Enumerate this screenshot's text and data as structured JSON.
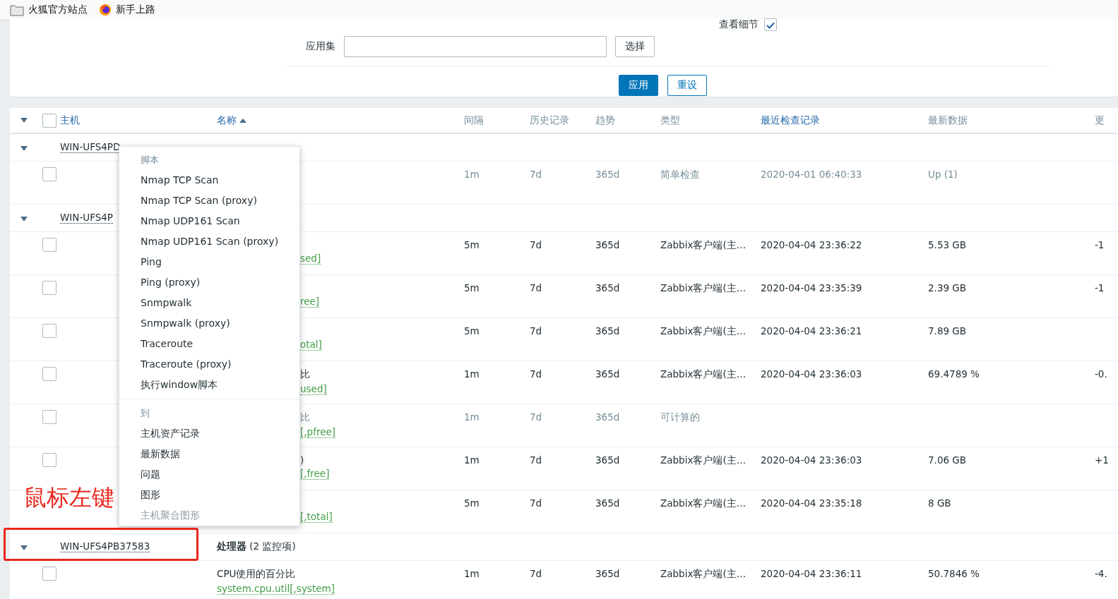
{
  "bookmarks": [
    {
      "label": "火狐官方站点"
    },
    {
      "label": "新手上路"
    }
  ],
  "filter": {
    "details_label": "查看细节",
    "details_checked": true,
    "app_label": "应用集",
    "select_button": "选择",
    "apply_button": "应用",
    "reset_button": "重设"
  },
  "table": {
    "header_checked": false,
    "columns": [
      {
        "label": "主机",
        "kind": "link"
      },
      {
        "label": "名称",
        "kind": "sorted"
      },
      {
        "label": "间隔",
        "kind": "plain"
      },
      {
        "label": "历史记录",
        "kind": "plain"
      },
      {
        "label": "趋势",
        "kind": "plain"
      },
      {
        "label": "类型",
        "kind": "plain"
      },
      {
        "label": "最近检查记录",
        "kind": "link"
      },
      {
        "label": "最新数据",
        "kind": "plain"
      },
      {
        "label": "更",
        "kind": "plain"
      }
    ],
    "groups": [
      {
        "host": "WIN-UFS4PD",
        "expanded": true,
        "rows": [
          {
            "checked": false,
            "disabled": true,
            "interval": "1m",
            "history": "7d",
            "trends": "365d",
            "type": "简单检查",
            "last_check": "2020-04-01 06:40:33",
            "last_value": "Up (1)"
          }
        ]
      },
      {
        "host": "WIN-UFS4P",
        "expanded": true,
        "rows": [
          {
            "checked": false,
            "disabled": false,
            "key": "sed]",
            "interval": "5m",
            "history": "7d",
            "trends": "365d",
            "type": "Zabbix客户端(主…",
            "last_check": "2020-04-04 23:36:22",
            "last_value": "5.53 GB",
            "change": "-1"
          },
          {
            "checked": false,
            "disabled": false,
            "key": "ree]",
            "interval": "5m",
            "history": "7d",
            "trends": "365d",
            "type": "Zabbix客户端(主…",
            "last_check": "2020-04-04 23:35:39",
            "last_value": "2.39 GB",
            "change": "-1"
          },
          {
            "checked": false,
            "disabled": false,
            "key": "otal]",
            "interval": "5m",
            "history": "7d",
            "trends": "365d",
            "type": "Zabbix客户端(主…",
            "last_check": "2020-04-04 23:36:21",
            "last_value": "7.89 GB"
          },
          {
            "checked": false,
            "disabled": false,
            "name": "比",
            "key": "used]",
            "interval": "1m",
            "history": "7d",
            "trends": "365d",
            "type": "Zabbix客户端(主…",
            "last_check": "2020-04-04 23:36:03",
            "last_value": "69.4789 %",
            "change": "-0."
          },
          {
            "checked": false,
            "disabled": true,
            "name": "比",
            "key": "[,pfree]",
            "interval": "1m",
            "history": "7d",
            "trends": "365d",
            "type": "可计算的"
          },
          {
            "checked": false,
            "disabled": false,
            "name": ")",
            "key": "[,free]",
            "interval": "1m",
            "history": "7d",
            "trends": "365d",
            "type": "Zabbix客户端(主…",
            "last_check": "2020-04-04 23:36:03",
            "last_value": "7.06 GB",
            "change": "+1"
          },
          {
            "disabled": false,
            "key": "[,total]",
            "interval": "5m",
            "history": "7d",
            "trends": "365d",
            "type": "Zabbix客户端(主…",
            "last_check": "2020-04-04 23:35:18",
            "last_value": "8 GB"
          }
        ]
      },
      {
        "host": "WIN-UFS4PB37583",
        "app": "处理器",
        "count": "(2 监控项)",
        "expanded": true,
        "rows": [
          {
            "checked": false,
            "disabled": false,
            "name": "CPU使用的百分比",
            "key": "system.cpu.util[,system]",
            "interval": "1m",
            "history": "7d",
            "trends": "365d",
            "type": "Zabbix客户端(主…",
            "last_check": "2020-04-04 23:36:11",
            "last_value": "50.7846 %",
            "change": "-4."
          }
        ]
      }
    ]
  },
  "context_menu": {
    "items": [
      {
        "kind": "header",
        "label": "脚本"
      },
      {
        "kind": "item",
        "label": "Nmap TCP Scan",
        "disabled": false
      },
      {
        "kind": "item",
        "label": "Nmap TCP Scan (proxy)",
        "disabled": false
      },
      {
        "kind": "item",
        "label": "Nmap UDP161 Scan",
        "disabled": false
      },
      {
        "kind": "item",
        "label": "Nmap UDP161 Scan (proxy)",
        "disabled": false
      },
      {
        "kind": "item",
        "label": "Ping",
        "disabled": false
      },
      {
        "kind": "item",
        "label": "Ping (proxy)",
        "disabled": false
      },
      {
        "kind": "item",
        "label": "Snmpwalk",
        "disabled": false
      },
      {
        "kind": "item",
        "label": "Snmpwalk (proxy)",
        "disabled": false
      },
      {
        "kind": "item",
        "label": "Traceroute",
        "disabled": false
      },
      {
        "kind": "item",
        "label": "Traceroute (proxy)",
        "disabled": false
      },
      {
        "kind": "item",
        "label": "执行window脚本",
        "disabled": false
      },
      {
        "kind": "separator"
      },
      {
        "kind": "header",
        "label": "到"
      },
      {
        "kind": "item",
        "label": "主机资产记录",
        "disabled": false
      },
      {
        "kind": "item",
        "label": "最新数据",
        "disabled": false
      },
      {
        "kind": "item",
        "label": "问题",
        "disabled": false
      },
      {
        "kind": "item",
        "label": "图形",
        "disabled": false
      },
      {
        "kind": "item",
        "label": "主机聚合图形",
        "disabled": true
      }
    ]
  },
  "annotation": {
    "text": "鼠标左键"
  }
}
